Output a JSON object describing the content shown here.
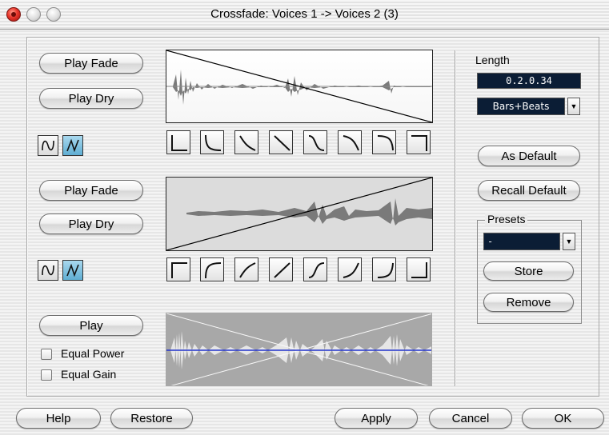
{
  "window": {
    "title": "Crossfade: Voices 1 -> Voices 2 (3)"
  },
  "fade_in_section": {
    "play_fade_label": "Play Fade",
    "play_dry_label": "Play Dry"
  },
  "fade_out_section": {
    "play_fade_label": "Play Fade",
    "play_dry_label": "Play Dry"
  },
  "summary_section": {
    "play_label": "Play",
    "equal_power_label": "Equal Power",
    "equal_power_checked": false,
    "equal_gain_label": "Equal Gain",
    "equal_gain_checked": false
  },
  "length": {
    "label": "Length",
    "value": "0.2.0.34",
    "format_selected": "Bars+Beats"
  },
  "defaults": {
    "as_default_label": "As Default",
    "recall_default_label": "Recall Default"
  },
  "presets": {
    "legend": "Presets",
    "selected": "-",
    "store_label": "Store",
    "remove_label": "Remove"
  },
  "bottom_bar": {
    "help_label": "Help",
    "restore_label": "Restore",
    "apply_label": "Apply",
    "cancel_label": "Cancel",
    "ok_label": "OK"
  },
  "colors": {
    "waveform": "#7a7a7a",
    "waveform_bg_top": "#ffffff",
    "waveform_bg_bottom": "#dddddd",
    "summary_bg": "#a8a8a8",
    "summary_line": "#2233cc",
    "toggle_active": "#6fb6db",
    "field_bg": "#0b1d35"
  },
  "icons": {
    "fade_mode_spline": "spline-curve-icon",
    "fade_mode_linear": "linear-curve-icon",
    "dropdown_arrow": "chevron-down-icon"
  }
}
